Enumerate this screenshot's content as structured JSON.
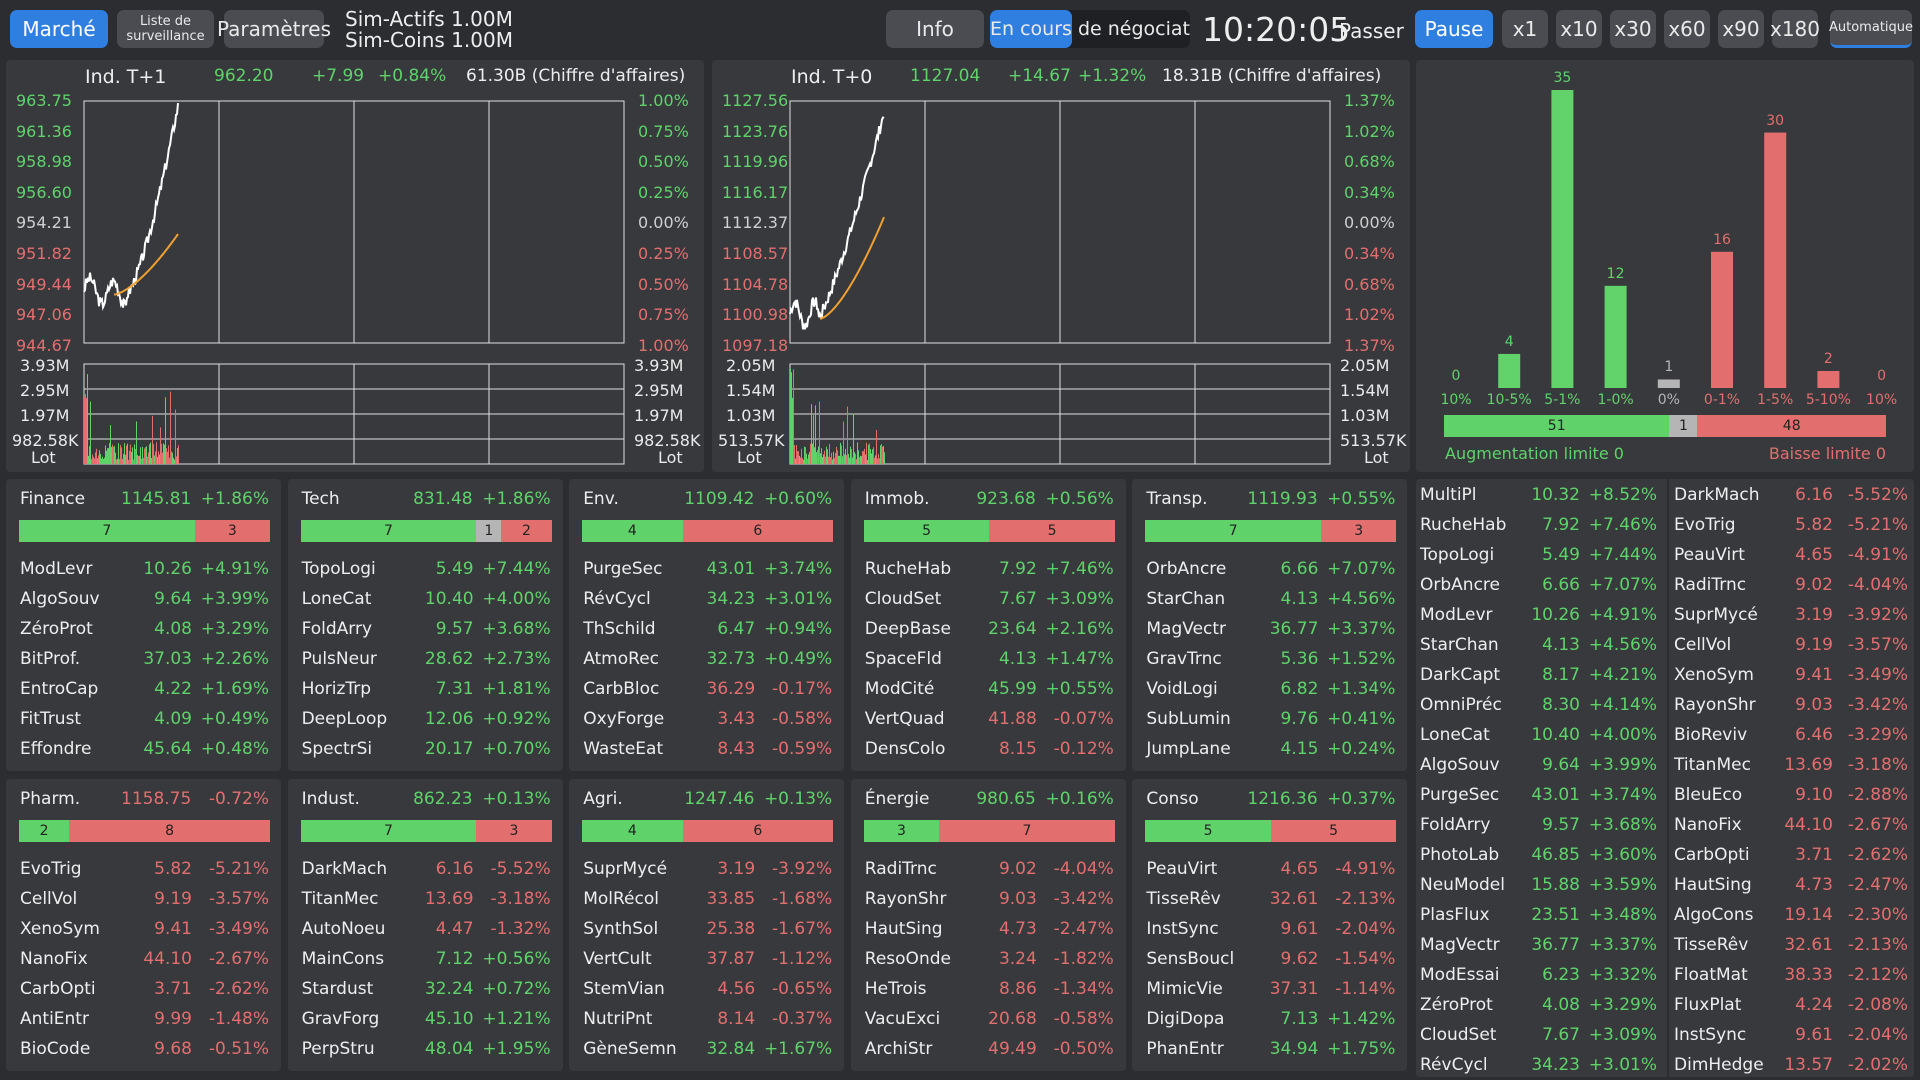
{
  "topbar": {
    "market": "Marché",
    "watchlist_line1": "Liste de",
    "watchlist_line2": "surveillance",
    "settings": "Paramètres",
    "sim_assets": "Sim-Actifs 1.00M",
    "sim_coins": "Sim-Coins 1.00M",
    "info": "Info",
    "status": "En cours de négociation",
    "clock": "10:20:05",
    "skip": "Passer",
    "pause": "Pause",
    "speeds": [
      "x1",
      "x10",
      "x30",
      "x60",
      "x90",
      "x180"
    ],
    "auto": "Automatique"
  },
  "charts": [
    {
      "name": "Ind. T+1",
      "price": "962.20",
      "change": "+7.99",
      "pct": "+0.84%",
      "turnover": "61.30B (Chiffre d'affaires)",
      "y_left": [
        "963.75",
        "961.36",
        "958.98",
        "956.60",
        "954.21",
        "951.82",
        "949.44",
        "947.06",
        "944.67"
      ],
      "y_right": [
        "1.00%",
        "0.75%",
        "0.50%",
        "0.25%",
        "0.00%",
        "0.25%",
        "0.50%",
        "0.75%",
        "1.00%"
      ],
      "vol_left": [
        "3.93M",
        "2.95M",
        "1.97M",
        "982.58K"
      ],
      "vol_right": [
        "3.93M",
        "2.95M",
        "1.97M",
        "982.58K"
      ],
      "lot": "Lot"
    },
    {
      "name": "Ind. T+0",
      "price": "1127.04",
      "change": "+14.67",
      "pct": "+1.32%",
      "turnover": "18.31B (Chiffre d'affaires)",
      "y_left": [
        "1127.56",
        "1123.76",
        "1119.96",
        "1116.17",
        "1112.37",
        "1108.57",
        "1104.78",
        "1100.98",
        "1097.18"
      ],
      "y_right": [
        "1.37%",
        "1.02%",
        "0.68%",
        "0.34%",
        "0.00%",
        "0.34%",
        "0.68%",
        "1.02%",
        "1.37%"
      ],
      "vol_left": [
        "2.05M",
        "1.54M",
        "1.03M",
        "513.57K"
      ],
      "vol_right": [
        "2.05M",
        "1.54M",
        "1.03M",
        "513.57K"
      ],
      "lot": "Lot"
    }
  ],
  "distribution": {
    "bars": [
      {
        "label": "10%",
        "count": "0",
        "color": "#62d36b"
      },
      {
        "label": "10-5%",
        "count": "4",
        "color": "#62d36b"
      },
      {
        "label": "5-1%",
        "count": "35",
        "color": "#62d36b"
      },
      {
        "label": "1-0%",
        "count": "12",
        "color": "#62d36b"
      },
      {
        "label": "0%",
        "count": "1",
        "color": "#b5b5b5"
      },
      {
        "label": "0-1%",
        "count": "16",
        "color": "#e36e6e"
      },
      {
        "label": "1-5%",
        "count": "30",
        "color": "#e36e6e"
      },
      {
        "label": "5-10%",
        "count": "2",
        "color": "#e36e6e"
      },
      {
        "label": "10%",
        "count": "0",
        "color": "#e36e6e"
      }
    ],
    "up": "51",
    "flat": "1",
    "down": "48",
    "limit_up": "Augmentation limite 0",
    "limit_down": "Baisse limite 0"
  },
  "sectors": [
    {
      "name": "Finance",
      "value": "1145.81",
      "pct": "+1.86%",
      "up": "7",
      "flat": "",
      "down": "3",
      "rows": [
        [
          "ModLevr",
          "10.26",
          "+4.91%"
        ],
        [
          "AlgoSouv",
          "9.64",
          "+3.99%"
        ],
        [
          "ZéroProt",
          "4.08",
          "+3.29%"
        ],
        [
          "BitProf.",
          "37.03",
          "+2.26%"
        ],
        [
          "EntroCap",
          "4.22",
          "+1.69%"
        ],
        [
          "FitTrust",
          "4.09",
          "+0.49%"
        ],
        [
          "Effondre",
          "45.64",
          "+0.48%"
        ]
      ]
    },
    {
      "name": "Tech",
      "value": "831.48",
      "pct": "+1.86%",
      "up": "7",
      "flat": "1",
      "down": "2",
      "rows": [
        [
          "TopoLogi",
          "5.49",
          "+7.44%"
        ],
        [
          "LoneCat",
          "10.40",
          "+4.00%"
        ],
        [
          "FoldArry",
          "9.57",
          "+3.68%"
        ],
        [
          "PulsNeur",
          "28.62",
          "+2.73%"
        ],
        [
          "HorizTrp",
          "7.31",
          "+1.81%"
        ],
        [
          "DeepLoop",
          "12.06",
          "+0.92%"
        ],
        [
          "SpectrSi",
          "20.17",
          "+0.70%"
        ]
      ]
    },
    {
      "name": "Env.",
      "value": "1109.42",
      "pct": "+0.60%",
      "up": "4",
      "flat": "",
      "down": "6",
      "rows": [
        [
          "PurgeSec",
          "43.01",
          "+3.74%"
        ],
        [
          "RévCycl",
          "34.23",
          "+3.01%"
        ],
        [
          "ThSchild",
          "6.47",
          "+0.94%"
        ],
        [
          "AtmoRec",
          "32.73",
          "+0.49%"
        ],
        [
          "CarbBloc",
          "36.29",
          "-0.17%"
        ],
        [
          "OxyForge",
          "3.43",
          "-0.58%"
        ],
        [
          "WasteEat",
          "8.43",
          "-0.59%"
        ]
      ]
    },
    {
      "name": "Immob.",
      "value": "923.68",
      "pct": "+0.56%",
      "up": "5",
      "flat": "",
      "down": "5",
      "rows": [
        [
          "RucheHab",
          "7.92",
          "+7.46%"
        ],
        [
          "CloudSet",
          "7.67",
          "+3.09%"
        ],
        [
          "DeepBase",
          "23.64",
          "+2.16%"
        ],
        [
          "SpaceFld",
          "4.13",
          "+1.47%"
        ],
        [
          "ModCité",
          "45.99",
          "+0.55%"
        ],
        [
          "VertQuad",
          "41.88",
          "-0.07%"
        ],
        [
          "DensColo",
          "8.15",
          "-0.12%"
        ]
      ]
    },
    {
      "name": "Transp.",
      "value": "1119.93",
      "pct": "+0.55%",
      "up": "7",
      "flat": "",
      "down": "3",
      "rows": [
        [
          "OrbAncre",
          "6.66",
          "+7.07%"
        ],
        [
          "StarChan",
          "4.13",
          "+4.56%"
        ],
        [
          "MagVectr",
          "36.77",
          "+3.37%"
        ],
        [
          "GravTrnc",
          "5.36",
          "+1.52%"
        ],
        [
          "VoidLogi",
          "6.82",
          "+1.34%"
        ],
        [
          "SubLumin",
          "9.76",
          "+0.41%"
        ],
        [
          "JumpLane",
          "4.15",
          "+0.24%"
        ]
      ]
    },
    {
      "name": "Pharm.",
      "value": "1158.75",
      "pct": "-0.72%",
      "up": "2",
      "flat": "",
      "down": "8",
      "rows": [
        [
          "EvoTrig",
          "5.82",
          "-5.21%"
        ],
        [
          "CellVol",
          "9.19",
          "-3.57%"
        ],
        [
          "XenoSym",
          "9.41",
          "-3.49%"
        ],
        [
          "NanoFix",
          "44.10",
          "-2.67%"
        ],
        [
          "CarbOpti",
          "3.71",
          "-2.62%"
        ],
        [
          "AntiEntr",
          "9.99",
          "-1.48%"
        ],
        [
          "BioCode",
          "9.68",
          "-0.51%"
        ]
      ]
    },
    {
      "name": "Indust.",
      "value": "862.23",
      "pct": "+0.13%",
      "up": "7",
      "flat": "",
      "down": "3",
      "rows": [
        [
          "DarkMach",
          "6.16",
          "-5.52%"
        ],
        [
          "TitanMec",
          "13.69",
          "-3.18%"
        ],
        [
          "AutoNoeu",
          "4.47",
          "-1.32%"
        ],
        [
          "MainCons",
          "7.12",
          "+0.56%"
        ],
        [
          "Stardust",
          "32.24",
          "+0.72%"
        ],
        [
          "GravForg",
          "45.10",
          "+1.21%"
        ],
        [
          "PerpStru",
          "48.04",
          "+1.95%"
        ]
      ]
    },
    {
      "name": "Agri.",
      "value": "1247.46",
      "pct": "+0.13%",
      "up": "4",
      "flat": "",
      "down": "6",
      "rows": [
        [
          "SuprMycé",
          "3.19",
          "-3.92%"
        ],
        [
          "MolRécol",
          "33.85",
          "-1.68%"
        ],
        [
          "SynthSol",
          "25.38",
          "-1.67%"
        ],
        [
          "VertCult",
          "37.87",
          "-1.12%"
        ],
        [
          "StemVian",
          "4.56",
          "-0.65%"
        ],
        [
          "NutriPnt",
          "8.14",
          "-0.37%"
        ],
        [
          "GèneSemn",
          "32.84",
          "+1.67%"
        ]
      ]
    },
    {
      "name": "Énergie",
      "value": "980.65",
      "pct": "+0.16%",
      "up": "3",
      "flat": "",
      "down": "7",
      "rows": [
        [
          "RadiTrnc",
          "9.02",
          "-4.04%"
        ],
        [
          "RayonShr",
          "9.03",
          "-3.42%"
        ],
        [
          "HautSing",
          "4.73",
          "-2.47%"
        ],
        [
          "ResoOnde",
          "3.24",
          "-1.82%"
        ],
        [
          "HeTrois",
          "8.86",
          "-1.34%"
        ],
        [
          "VacuExci",
          "20.68",
          "-0.58%"
        ],
        [
          "ArchiStr",
          "49.49",
          "-0.50%"
        ]
      ]
    },
    {
      "name": "Conso",
      "value": "1216.36",
      "pct": "+0.37%",
      "up": "5",
      "flat": "",
      "down": "5",
      "rows": [
        [
          "PeauVirt",
          "4.65",
          "-4.91%"
        ],
        [
          "TisseRêv",
          "32.61",
          "-2.13%"
        ],
        [
          "InstSync",
          "9.61",
          "-2.04%"
        ],
        [
          "SensBoucl",
          "9.62",
          "-1.54%"
        ],
        [
          "MimicVie",
          "37.31",
          "-1.14%"
        ],
        [
          "DigiDopa",
          "7.13",
          "+1.42%"
        ],
        [
          "PhanEntr",
          "34.94",
          "+1.75%"
        ]
      ]
    }
  ],
  "gainers": [
    [
      "MultiPl",
      "10.32",
      "+8.52%"
    ],
    [
      "RucheHab",
      "7.92",
      "+7.46%"
    ],
    [
      "TopoLogi",
      "5.49",
      "+7.44%"
    ],
    [
      "OrbAncre",
      "6.66",
      "+7.07%"
    ],
    [
      "ModLevr",
      "10.26",
      "+4.91%"
    ],
    [
      "StarChan",
      "4.13",
      "+4.56%"
    ],
    [
      "DarkCapt",
      "8.17",
      "+4.21%"
    ],
    [
      "OmniPréc",
      "8.30",
      "+4.14%"
    ],
    [
      "LoneCat",
      "10.40",
      "+4.00%"
    ],
    [
      "AlgoSouv",
      "9.64",
      "+3.99%"
    ],
    [
      "PurgeSec",
      "43.01",
      "+3.74%"
    ],
    [
      "FoldArry",
      "9.57",
      "+3.68%"
    ],
    [
      "PhotoLab",
      "46.85",
      "+3.60%"
    ],
    [
      "NeuModel",
      "15.88",
      "+3.59%"
    ],
    [
      "PlasFlux",
      "23.51",
      "+3.48%"
    ],
    [
      "MagVectr",
      "36.77",
      "+3.37%"
    ],
    [
      "ModEssai",
      "6.23",
      "+3.32%"
    ],
    [
      "ZéroProt",
      "4.08",
      "+3.29%"
    ],
    [
      "CloudSet",
      "7.67",
      "+3.09%"
    ],
    [
      "RévCycl",
      "34.23",
      "+3.01%"
    ]
  ],
  "losers": [
    [
      "DarkMach",
      "6.16",
      "-5.52%"
    ],
    [
      "EvoTrig",
      "5.82",
      "-5.21%"
    ],
    [
      "PeauVirt",
      "4.65",
      "-4.91%"
    ],
    [
      "RadiTrnc",
      "9.02",
      "-4.04%"
    ],
    [
      "SuprMycé",
      "3.19",
      "-3.92%"
    ],
    [
      "CellVol",
      "9.19",
      "-3.57%"
    ],
    [
      "XenoSym",
      "9.41",
      "-3.49%"
    ],
    [
      "RayonShr",
      "9.03",
      "-3.42%"
    ],
    [
      "BioReviv",
      "6.46",
      "-3.29%"
    ],
    [
      "TitanMec",
      "13.69",
      "-3.18%"
    ],
    [
      "BleuEco",
      "9.10",
      "-2.88%"
    ],
    [
      "NanoFix",
      "44.10",
      "-2.67%"
    ],
    [
      "CarbOpti",
      "3.71",
      "-2.62%"
    ],
    [
      "HautSing",
      "4.73",
      "-2.47%"
    ],
    [
      "AlgoCons",
      "19.14",
      "-2.30%"
    ],
    [
      "TisseRêv",
      "32.61",
      "-2.13%"
    ],
    [
      "FloatMat",
      "38.33",
      "-2.12%"
    ],
    [
      "FluxPlat",
      "4.24",
      "-2.08%"
    ],
    [
      "InstSync",
      "9.61",
      "-2.04%"
    ],
    [
      "DimHedge",
      "13.57",
      "-2.02%"
    ]
  ],
  "colors": {
    "up": "#5fd36a",
    "down": "#e36e6e",
    "flat": "#b5b5b5",
    "accent": "#2f7fe0",
    "panel": "#37393d",
    "bg": "#2b2d31",
    "avg_line": "#f0a030"
  }
}
